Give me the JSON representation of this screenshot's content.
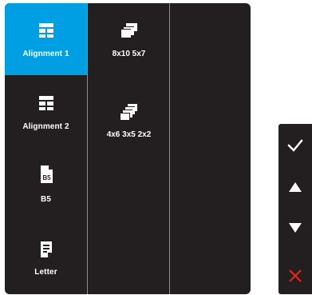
{
  "menu": {
    "items": [
      {
        "label": "Alignment 1",
        "icon": "alignment-icon",
        "selected": true
      },
      {
        "label": "Alignment 2",
        "icon": "alignment-icon",
        "selected": false
      },
      {
        "label": "B5",
        "icon": "document-b5-icon",
        "selected": false
      },
      {
        "label": "Letter",
        "icon": "document-letter-icon",
        "selected": false
      }
    ]
  },
  "submenu": {
    "items": [
      {
        "label": "8x10 5x7",
        "icon": "stacked-frames-icon"
      },
      {
        "label": "4x6 3x5 2x2",
        "icon": "stacked-frames-icon"
      }
    ]
  },
  "doc_icon_text": "B5",
  "nav": {
    "buttons": [
      "confirm-check-icon",
      "up-arrow-icon",
      "down-arrow-icon",
      "close-x-icon"
    ]
  },
  "colors": {
    "panel_background": "#231f20",
    "selected_background": "#009fe3",
    "text": "#ffffff",
    "divider": "#8c8c8c",
    "close_icon": "#e1251b"
  }
}
